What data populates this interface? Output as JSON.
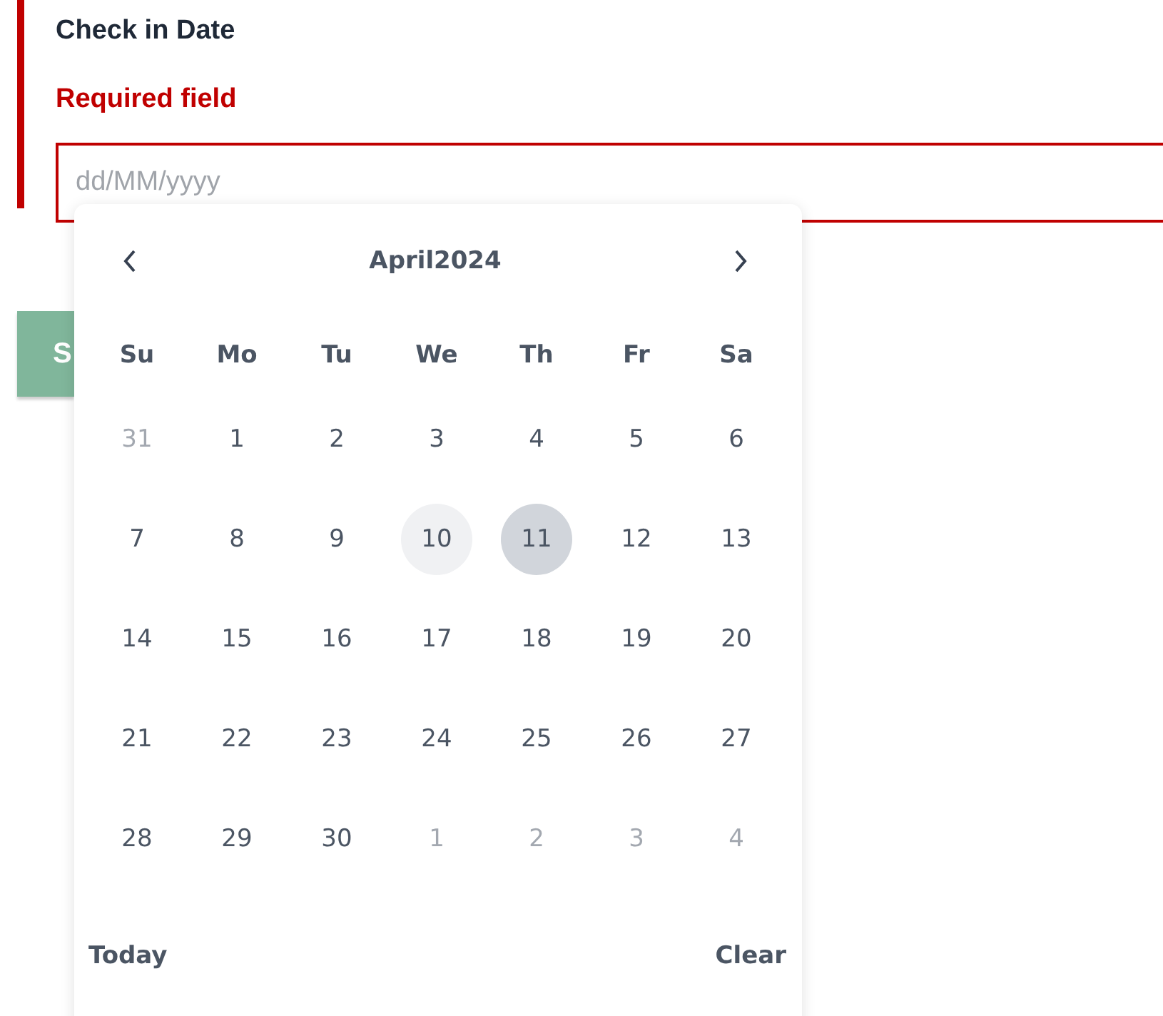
{
  "field": {
    "label": "Check in Date",
    "error": "Required field",
    "placeholder": "dd/MM/yyyy",
    "invalid": true
  },
  "submit_button": {
    "label": "S"
  },
  "date_picker": {
    "title": "April2024",
    "weekdays": [
      "Su",
      "Mo",
      "Tu",
      "We",
      "Th",
      "Fr",
      "Sa"
    ],
    "weeks": [
      [
        {
          "label": "31",
          "outside": true,
          "today": false,
          "selected": false
        },
        {
          "label": "1",
          "outside": false,
          "today": false,
          "selected": false
        },
        {
          "label": "2",
          "outside": false,
          "today": false,
          "selected": false
        },
        {
          "label": "3",
          "outside": false,
          "today": false,
          "selected": false
        },
        {
          "label": "4",
          "outside": false,
          "today": false,
          "selected": false
        },
        {
          "label": "5",
          "outside": false,
          "today": false,
          "selected": false
        },
        {
          "label": "6",
          "outside": false,
          "today": false,
          "selected": false
        }
      ],
      [
        {
          "label": "7",
          "outside": false,
          "today": false,
          "selected": false
        },
        {
          "label": "8",
          "outside": false,
          "today": false,
          "selected": false
        },
        {
          "label": "9",
          "outside": false,
          "today": false,
          "selected": false
        },
        {
          "label": "10",
          "outside": false,
          "today": true,
          "selected": false
        },
        {
          "label": "11",
          "outside": false,
          "today": false,
          "selected": true
        },
        {
          "label": "12",
          "outside": false,
          "today": false,
          "selected": false
        },
        {
          "label": "13",
          "outside": false,
          "today": false,
          "selected": false
        }
      ],
      [
        {
          "label": "14",
          "outside": false,
          "today": false,
          "selected": false
        },
        {
          "label": "15",
          "outside": false,
          "today": false,
          "selected": false
        },
        {
          "label": "16",
          "outside": false,
          "today": false,
          "selected": false
        },
        {
          "label": "17",
          "outside": false,
          "today": false,
          "selected": false
        },
        {
          "label": "18",
          "outside": false,
          "today": false,
          "selected": false
        },
        {
          "label": "19",
          "outside": false,
          "today": false,
          "selected": false
        },
        {
          "label": "20",
          "outside": false,
          "today": false,
          "selected": false
        }
      ],
      [
        {
          "label": "21",
          "outside": false,
          "today": false,
          "selected": false
        },
        {
          "label": "22",
          "outside": false,
          "today": false,
          "selected": false
        },
        {
          "label": "23",
          "outside": false,
          "today": false,
          "selected": false
        },
        {
          "label": "24",
          "outside": false,
          "today": false,
          "selected": false
        },
        {
          "label": "25",
          "outside": false,
          "today": false,
          "selected": false
        },
        {
          "label": "26",
          "outside": false,
          "today": false,
          "selected": false
        },
        {
          "label": "27",
          "outside": false,
          "today": false,
          "selected": false
        }
      ],
      [
        {
          "label": "28",
          "outside": false,
          "today": false,
          "selected": false
        },
        {
          "label": "29",
          "outside": false,
          "today": false,
          "selected": false
        },
        {
          "label": "30",
          "outside": false,
          "today": false,
          "selected": false
        },
        {
          "label": "1",
          "outside": true,
          "today": false,
          "selected": false
        },
        {
          "label": "2",
          "outside": true,
          "today": false,
          "selected": false
        },
        {
          "label": "3",
          "outside": true,
          "today": false,
          "selected": false
        },
        {
          "label": "4",
          "outside": true,
          "today": false,
          "selected": false
        }
      ]
    ],
    "footer_buttons": [
      "Today",
      "Clear"
    ]
  }
}
